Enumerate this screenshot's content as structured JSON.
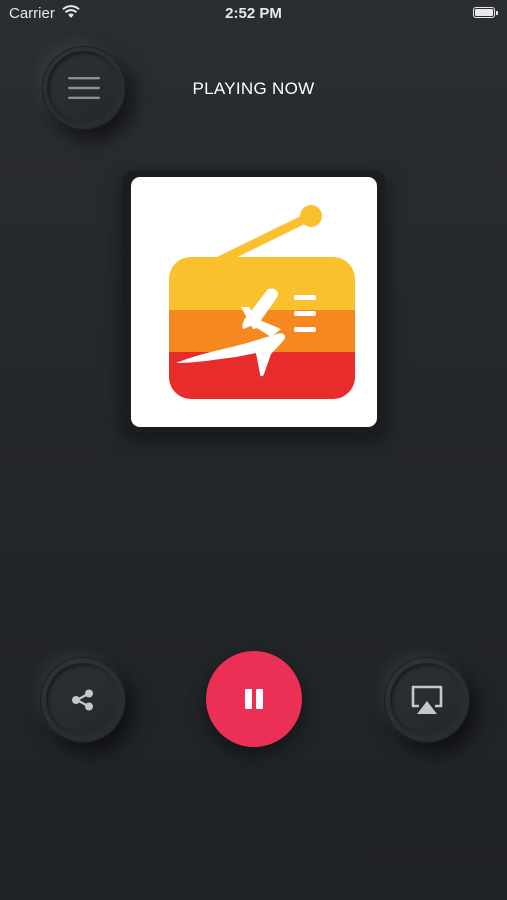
{
  "status_bar": {
    "carrier": "Carrier",
    "time": "2:52 PM"
  },
  "header": {
    "title": "PLAYING NOW",
    "menu_icon": "hamburger-menu-icon"
  },
  "artwork": {
    "logo_icon": "radio-airplane-logo"
  },
  "controls": {
    "share_icon": "share-icon",
    "pause_icon": "pause-icon",
    "airplay_icon": "airplay-icon"
  },
  "colors": {
    "play_button": "#ec2f55",
    "background": "#25282c",
    "logo_yellow": "#fbc02d",
    "logo_orange": "#f5891f",
    "logo_red": "#e82b2b"
  }
}
